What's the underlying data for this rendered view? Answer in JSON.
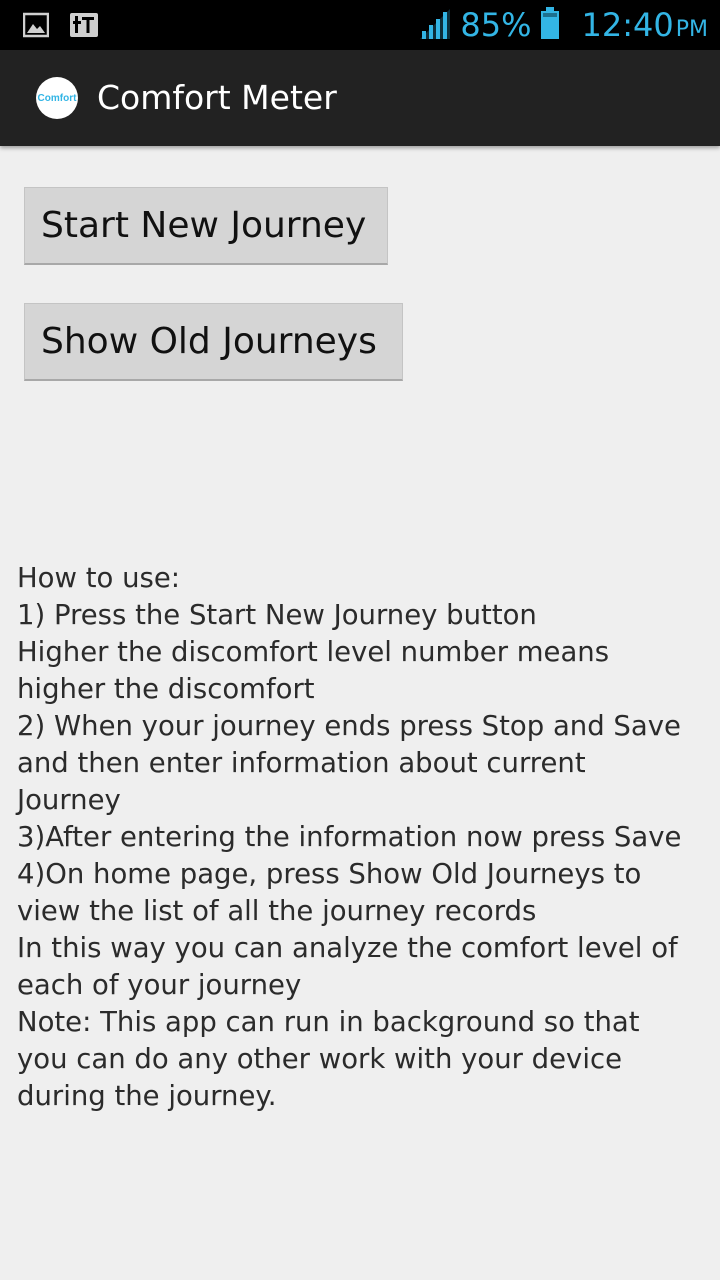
{
  "status_bar": {
    "left_icons": [
      "image-icon",
      "tt-icon"
    ],
    "signal_icon": "signal-icon",
    "battery_percent": "85%",
    "battery_icon": "battery-icon",
    "time": "12:40",
    "ampm": "PM",
    "accent_color": "#33b5e5"
  },
  "action_bar": {
    "app_icon_text": "Comfort",
    "title": "Comfort Meter"
  },
  "buttons": {
    "start_new_journey": "Start New Journey",
    "show_old_journeys": "Show Old Journeys"
  },
  "help_lines": [
    "How to use:",
    "1) Press the Start New Journey button",
    "Higher the discomfort level number means",
    "higher the discomfort",
    "2) When your journey ends press Stop and Save",
    "and then enter information about current",
    "Journey",
    "3)After entering the information now press Save",
    "4)On home page, press Show Old Journeys to",
    "view the list of all the journey records",
    "In this way you can analyze the comfort level of",
    "each of your journey",
    "Note: This app can run in background so that",
    "you can do any other work with your device",
    "during the journey."
  ]
}
